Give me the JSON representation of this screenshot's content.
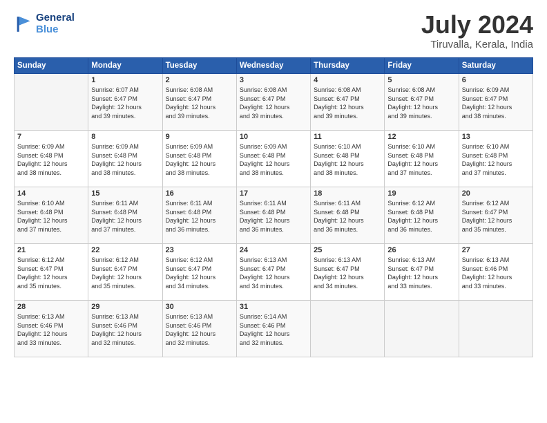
{
  "header": {
    "logo_line1": "General",
    "logo_line2": "Blue",
    "month_year": "July 2024",
    "location": "Tiruvalla, Kerala, India"
  },
  "days_of_week": [
    "Sunday",
    "Monday",
    "Tuesday",
    "Wednesday",
    "Thursday",
    "Friday",
    "Saturday"
  ],
  "weeks": [
    [
      {
        "day": "",
        "detail": ""
      },
      {
        "day": "1",
        "detail": "Sunrise: 6:07 AM\nSunset: 6:47 PM\nDaylight: 12 hours\nand 39 minutes."
      },
      {
        "day": "2",
        "detail": "Sunrise: 6:08 AM\nSunset: 6:47 PM\nDaylight: 12 hours\nand 39 minutes."
      },
      {
        "day": "3",
        "detail": "Sunrise: 6:08 AM\nSunset: 6:47 PM\nDaylight: 12 hours\nand 39 minutes."
      },
      {
        "day": "4",
        "detail": "Sunrise: 6:08 AM\nSunset: 6:47 PM\nDaylight: 12 hours\nand 39 minutes."
      },
      {
        "day": "5",
        "detail": "Sunrise: 6:08 AM\nSunset: 6:47 PM\nDaylight: 12 hours\nand 39 minutes."
      },
      {
        "day": "6",
        "detail": "Sunrise: 6:09 AM\nSunset: 6:47 PM\nDaylight: 12 hours\nand 38 minutes."
      }
    ],
    [
      {
        "day": "7",
        "detail": "Sunrise: 6:09 AM\nSunset: 6:48 PM\nDaylight: 12 hours\nand 38 minutes."
      },
      {
        "day": "8",
        "detail": "Sunrise: 6:09 AM\nSunset: 6:48 PM\nDaylight: 12 hours\nand 38 minutes."
      },
      {
        "day": "9",
        "detail": "Sunrise: 6:09 AM\nSunset: 6:48 PM\nDaylight: 12 hours\nand 38 minutes."
      },
      {
        "day": "10",
        "detail": "Sunrise: 6:09 AM\nSunset: 6:48 PM\nDaylight: 12 hours\nand 38 minutes."
      },
      {
        "day": "11",
        "detail": "Sunrise: 6:10 AM\nSunset: 6:48 PM\nDaylight: 12 hours\nand 38 minutes."
      },
      {
        "day": "12",
        "detail": "Sunrise: 6:10 AM\nSunset: 6:48 PM\nDaylight: 12 hours\nand 37 minutes."
      },
      {
        "day": "13",
        "detail": "Sunrise: 6:10 AM\nSunset: 6:48 PM\nDaylight: 12 hours\nand 37 minutes."
      }
    ],
    [
      {
        "day": "14",
        "detail": "Sunrise: 6:10 AM\nSunset: 6:48 PM\nDaylight: 12 hours\nand 37 minutes."
      },
      {
        "day": "15",
        "detail": "Sunrise: 6:11 AM\nSunset: 6:48 PM\nDaylight: 12 hours\nand 37 minutes."
      },
      {
        "day": "16",
        "detail": "Sunrise: 6:11 AM\nSunset: 6:48 PM\nDaylight: 12 hours\nand 36 minutes."
      },
      {
        "day": "17",
        "detail": "Sunrise: 6:11 AM\nSunset: 6:48 PM\nDaylight: 12 hours\nand 36 minutes."
      },
      {
        "day": "18",
        "detail": "Sunrise: 6:11 AM\nSunset: 6:48 PM\nDaylight: 12 hours\nand 36 minutes."
      },
      {
        "day": "19",
        "detail": "Sunrise: 6:12 AM\nSunset: 6:48 PM\nDaylight: 12 hours\nand 36 minutes."
      },
      {
        "day": "20",
        "detail": "Sunrise: 6:12 AM\nSunset: 6:47 PM\nDaylight: 12 hours\nand 35 minutes."
      }
    ],
    [
      {
        "day": "21",
        "detail": "Sunrise: 6:12 AM\nSunset: 6:47 PM\nDaylight: 12 hours\nand 35 minutes."
      },
      {
        "day": "22",
        "detail": "Sunrise: 6:12 AM\nSunset: 6:47 PM\nDaylight: 12 hours\nand 35 minutes."
      },
      {
        "day": "23",
        "detail": "Sunrise: 6:12 AM\nSunset: 6:47 PM\nDaylight: 12 hours\nand 34 minutes."
      },
      {
        "day": "24",
        "detail": "Sunrise: 6:13 AM\nSunset: 6:47 PM\nDaylight: 12 hours\nand 34 minutes."
      },
      {
        "day": "25",
        "detail": "Sunrise: 6:13 AM\nSunset: 6:47 PM\nDaylight: 12 hours\nand 34 minutes."
      },
      {
        "day": "26",
        "detail": "Sunrise: 6:13 AM\nSunset: 6:47 PM\nDaylight: 12 hours\nand 33 minutes."
      },
      {
        "day": "27",
        "detail": "Sunrise: 6:13 AM\nSunset: 6:46 PM\nDaylight: 12 hours\nand 33 minutes."
      }
    ],
    [
      {
        "day": "28",
        "detail": "Sunrise: 6:13 AM\nSunset: 6:46 PM\nDaylight: 12 hours\nand 33 minutes."
      },
      {
        "day": "29",
        "detail": "Sunrise: 6:13 AM\nSunset: 6:46 PM\nDaylight: 12 hours\nand 32 minutes."
      },
      {
        "day": "30",
        "detail": "Sunrise: 6:13 AM\nSunset: 6:46 PM\nDaylight: 12 hours\nand 32 minutes."
      },
      {
        "day": "31",
        "detail": "Sunrise: 6:14 AM\nSunset: 6:46 PM\nDaylight: 12 hours\nand 32 minutes."
      },
      {
        "day": "",
        "detail": ""
      },
      {
        "day": "",
        "detail": ""
      },
      {
        "day": "",
        "detail": ""
      }
    ]
  ]
}
